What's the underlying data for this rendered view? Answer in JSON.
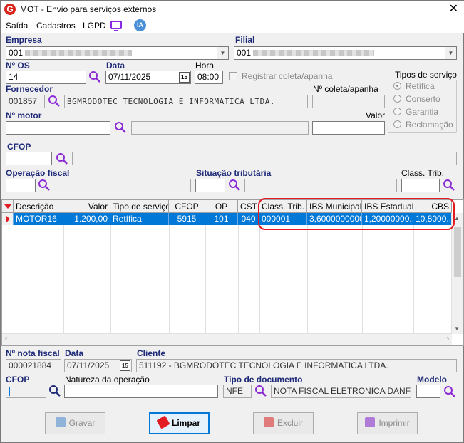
{
  "window": {
    "title": "MOT - Envio para serviços externos",
    "app_icon": "G"
  },
  "menu": {
    "items": [
      "Saída",
      "Cadastros",
      "LGPD"
    ],
    "ia_label": "IA"
  },
  "empresa": {
    "label": "Empresa",
    "value": "001"
  },
  "filial": {
    "label": "Filial",
    "value": "001"
  },
  "os": {
    "label": "Nº OS",
    "value": "14"
  },
  "data": {
    "label": "Data",
    "value": "07/11/2025",
    "cal_label": "15"
  },
  "hora": {
    "label": "Hora",
    "value": "08:00"
  },
  "registrar": {
    "label": "Registrar coleta/apanha",
    "checked": false
  },
  "tipos_servico": {
    "title": "Tipos de serviço",
    "options": [
      "Retífica",
      "Conserto",
      "Garantia",
      "Reclamação"
    ],
    "selected": "Retífica"
  },
  "fornecedor": {
    "label": "Fornecedor",
    "code": "001857",
    "name": "BGMRODOTEC TECNOLOGIA E INFORMATICA LTDA."
  },
  "coleta": {
    "label": "Nº coleta/apanha",
    "value": ""
  },
  "motor": {
    "label": "Nº  motor",
    "value": "",
    "desc": ""
  },
  "valor": {
    "label": "Valor",
    "value": ""
  },
  "cfop_top": {
    "label": "CFOP",
    "value": "",
    "desc": ""
  },
  "operacao_fiscal": {
    "label": "Operação fiscal",
    "value": ""
  },
  "situacao_tributaria": {
    "label": "Situação tributária",
    "value": ""
  },
  "class_trib": {
    "label": "Class. Trib.",
    "value": ""
  },
  "grid": {
    "columns": [
      "Descrição",
      "Valor",
      "Tipo de serviço",
      "CFOP",
      "OP",
      "CST",
      "Class. Trib.",
      "IBS Municipal",
      "IBS Estadual",
      "CBS"
    ],
    "rows": [
      [
        "MOTOR16",
        "1.200,00",
        "Retífica",
        "5915",
        "101",
        "040",
        "000001",
        "3,6000000000",
        "1,20000000...",
        "10,8000..."
      ]
    ]
  },
  "nota_fiscal": {
    "label": "Nº nota fiscal",
    "value": "000021884"
  },
  "data_nf": {
    "label": "Data",
    "value": "07/11/2025",
    "cal_label": "15"
  },
  "cliente": {
    "label": "Cliente",
    "value": "511192 - BGMRODOTEC TECNOLOGIA E INFORMATICA LTDA."
  },
  "cfop_bottom": {
    "label": "CFOP",
    "value": ""
  },
  "natureza": {
    "label": "Natureza da operação",
    "value": ""
  },
  "tipo_documento": {
    "label": "Tipo de documento",
    "code": "NFE",
    "desc": "NOTA FISCAL ELETRONICA DANFE"
  },
  "modelo": {
    "label": "Modelo",
    "value": ""
  },
  "buttons": {
    "gravar": "Gravar",
    "limpar": "Limpar",
    "excluir": "Excluir",
    "imprimir": "Imprimir"
  },
  "colors": {
    "accent": "#1e2a78",
    "selection": "#0078d7",
    "highlight": "#e31b23"
  }
}
